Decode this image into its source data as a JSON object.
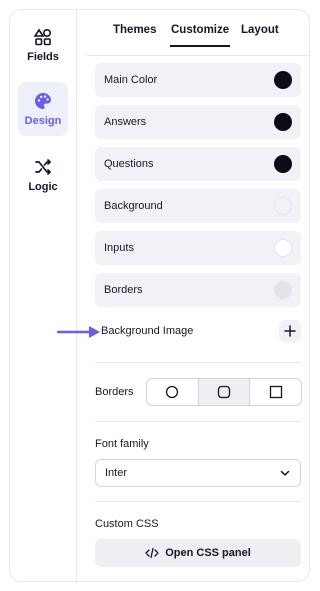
{
  "sidebar": {
    "items": [
      {
        "label": "Fields",
        "icon": "shapes-icon",
        "active": false
      },
      {
        "label": "Design",
        "icon": "palette-icon",
        "active": true
      },
      {
        "label": "Logic",
        "icon": "shuffle-icon",
        "active": false
      }
    ]
  },
  "tabs": [
    {
      "label": "Themes",
      "active": false
    },
    {
      "label": "Customize",
      "active": true
    },
    {
      "label": "Layout",
      "active": false
    }
  ],
  "colors": [
    {
      "label": "Main Color",
      "swatch": "#0b0b1a"
    },
    {
      "label": "Answers",
      "swatch": "#0b0b1a"
    },
    {
      "label": "Questions",
      "swatch": "#0b0b1a"
    },
    {
      "label": "Background",
      "swatch": "#f1f2f7"
    },
    {
      "label": "Inputs",
      "swatch": "#ffffff"
    },
    {
      "label": "Borders",
      "swatch": "#e3e4ea"
    }
  ],
  "background_image": {
    "label": "Background Image",
    "add_icon": "plus-icon"
  },
  "borders": {
    "label": "Borders",
    "options": [
      "rounded-full",
      "rounded",
      "square"
    ],
    "selected": "rounded"
  },
  "font_family": {
    "label": "Font family",
    "value": "Inter"
  },
  "custom_css": {
    "label": "Custom CSS",
    "button_label": "Open CSS panel"
  },
  "accent_color": "#6b5cf0"
}
